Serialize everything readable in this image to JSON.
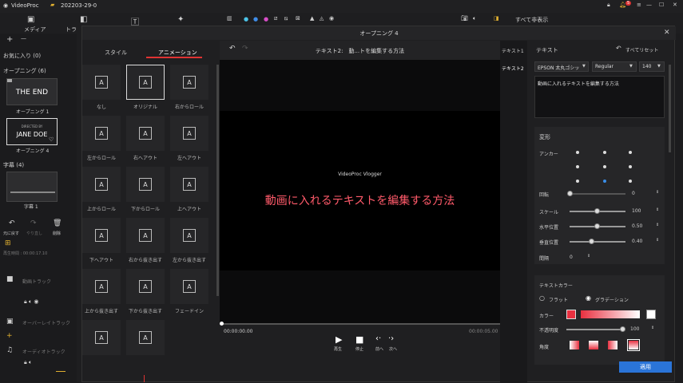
{
  "app": {
    "name": "VideoProc",
    "project": "202203-29-0",
    "badge": "5"
  },
  "tabs": [
    "メディア",
    "トラ"
  ],
  "left": {
    "favorites": "お気に入り (0)",
    "opening": "オープニング (6)",
    "card1_text": "THE END",
    "card1_label": "オープニング 1",
    "card2_small": "DIRECTED BY",
    "card2_text": "JANE DOE",
    "card2_label": "オープニング 4",
    "subtitles": "字幕 (4)",
    "sub_label": "字幕 1"
  },
  "toolbar_left": {
    "back": "元に戻す",
    "redo": "やり直し",
    "delete": "削除"
  },
  "tracks": {
    "time": "再生時間 : 00:00:17.10",
    "video": "動画トラック",
    "overlay": "オーバーレイトラック",
    "audio": "オーディオトラック"
  },
  "topright": {
    "show_all": "すべて非表示"
  },
  "dialog": {
    "title": "オープニング 4",
    "header": "テキスト2:　動...トを編集する方法",
    "tab_style": "スタイル",
    "tab_anim": "アニメーション",
    "anims": [
      "なし",
      "オリジナル",
      "右からロール",
      "左からロール",
      "右へアウト",
      "左へアウト",
      "上からロール",
      "下からロール",
      "上へアウト",
      "下へアウト",
      "右から抜き出す",
      "左から抜き出す",
      "上から抜き出す",
      "下から抜き出す",
      "フェードイン",
      "",
      ""
    ],
    "preview_small": "VideoProc Vlogger",
    "preview_main": "動画に入れるテキストを編集する方法",
    "time_start": "00:00:00.00",
    "time_end": "00:00:05.00",
    "ctrl": [
      "再生",
      "停止",
      "前へ",
      "次へ"
    ],
    "layer1": "テキスト1",
    "layer2": "テキスト2",
    "text_panel": "テキスト",
    "reset": "すべてリセット",
    "font": "EPSON 太丸ゴシッ",
    "weight": "Regular",
    "size": "140",
    "text_value": "動画に入れるテキストを編集する方法",
    "transform": "変形",
    "anchor": "アンカー",
    "rotate": "回転",
    "rotate_v": "0",
    "scale": "スケール",
    "scale_v": "100",
    "hpos": "水平位置",
    "hpos_v": "0.50",
    "vpos": "垂直位置",
    "vpos_v": "0.40",
    "spacing": "間隔",
    "spacing_v": "0",
    "text_color": "テキストカラー",
    "flat": "フラット",
    "gradient": "グラデーション",
    "color": "カラー",
    "opacity": "不透明度",
    "opacity_v": "100",
    "angle": "角度",
    "apply": "適用"
  }
}
